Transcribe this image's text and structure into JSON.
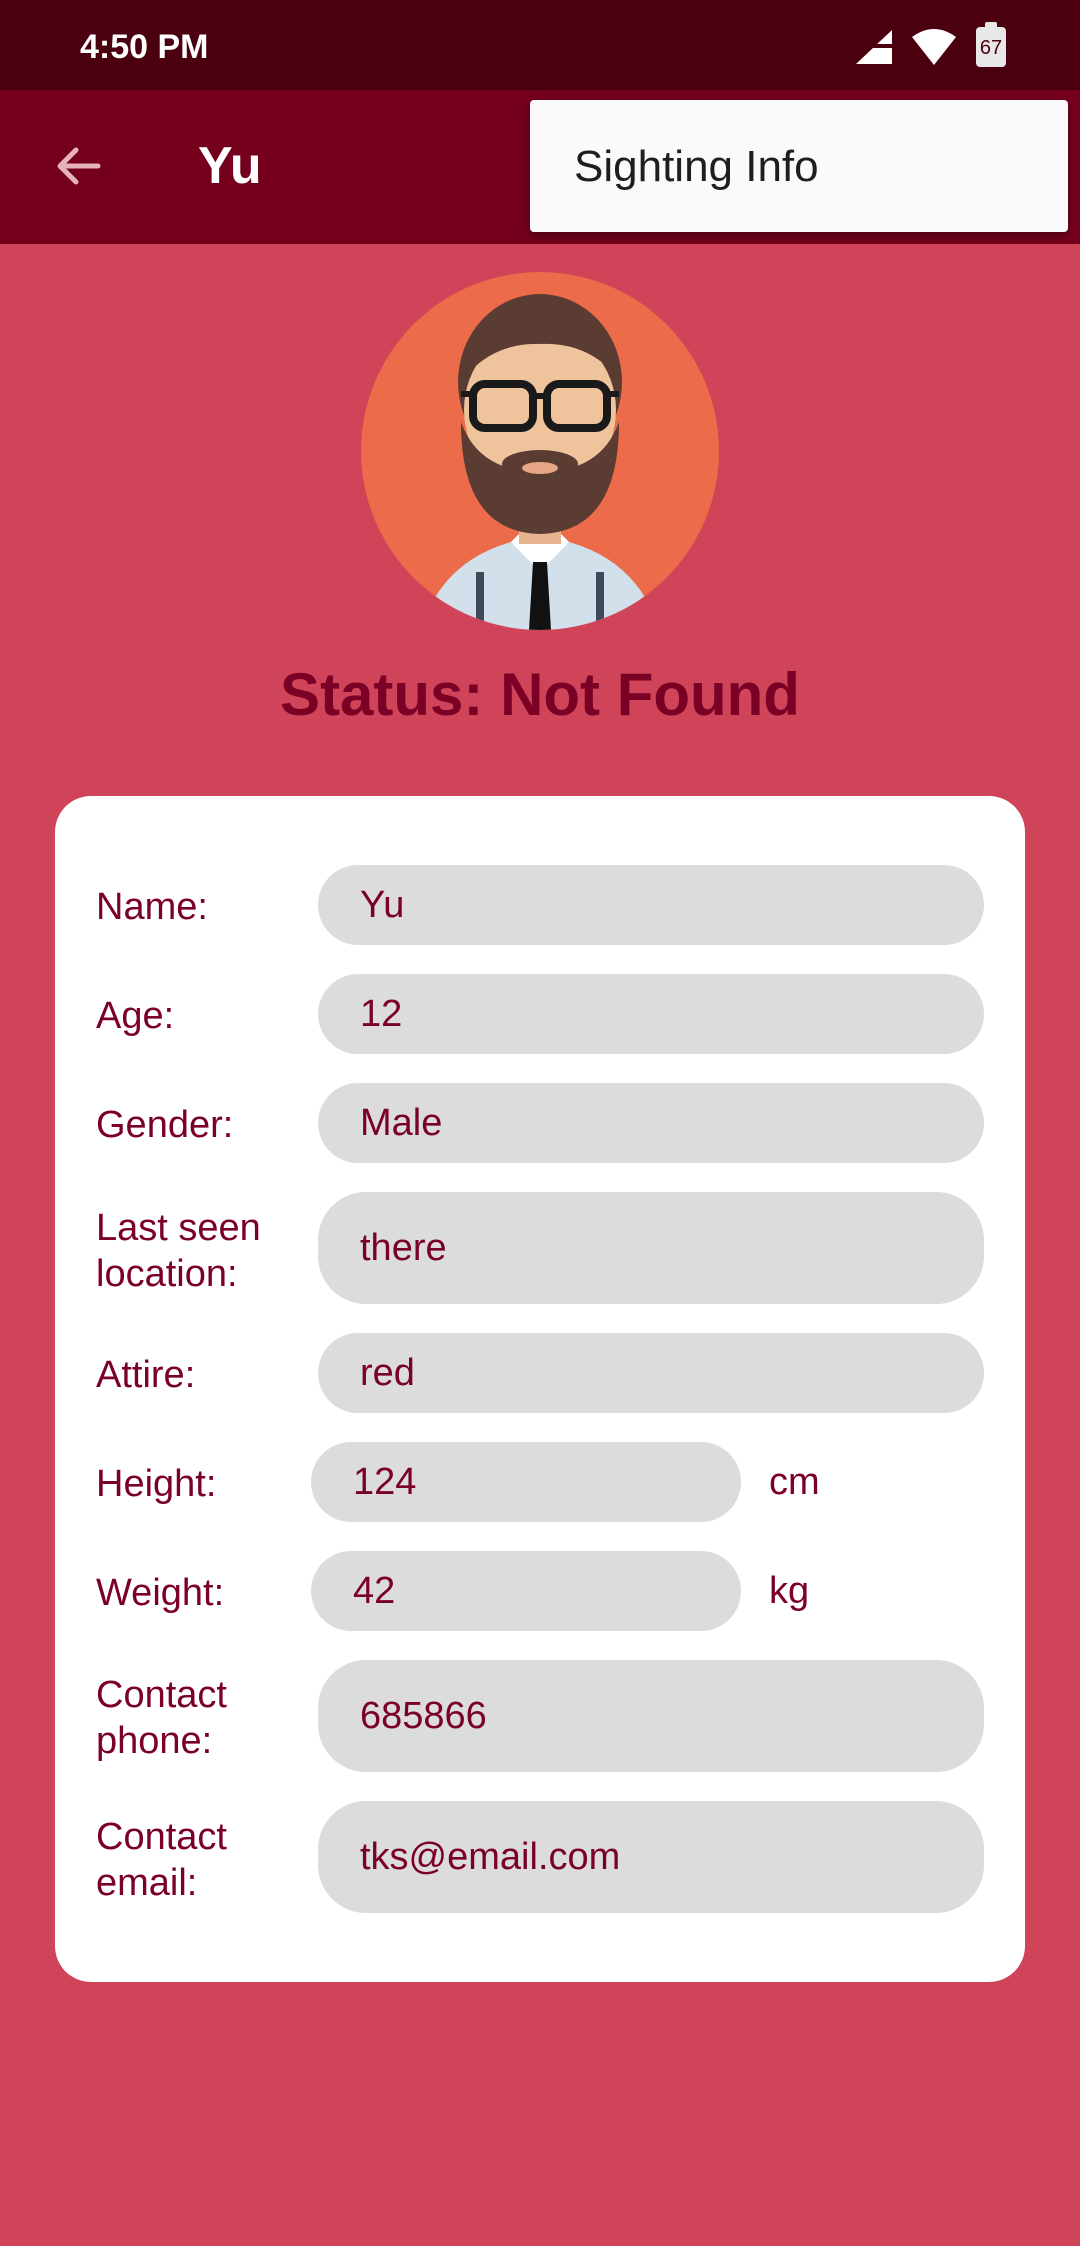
{
  "status_bar": {
    "time": "4:50 PM",
    "battery": "67"
  },
  "app_bar": {
    "title": "Yu"
  },
  "menu": {
    "item": "Sighting Info"
  },
  "status": "Status: Not Found",
  "form": {
    "name": {
      "label": "Name:",
      "value": "Yu"
    },
    "age": {
      "label": "Age:",
      "value": "12"
    },
    "gender": {
      "label": "Gender:",
      "value": "Male"
    },
    "location": {
      "label_line1": "Last seen",
      "label_line2": "location:",
      "value": "there"
    },
    "attire": {
      "label": "Attire:",
      "value": "red"
    },
    "height": {
      "label": "Height:",
      "value": "124",
      "unit": "cm"
    },
    "weight": {
      "label": "Weight:",
      "value": "42",
      "unit": "kg"
    },
    "phone": {
      "label_line1": "Contact",
      "label_line2": "phone:",
      "value": "685866"
    },
    "email": {
      "label_line1": "Contact",
      "label_line2": "email:",
      "value": "tks@email.com"
    }
  },
  "colors": {
    "background": "#cf4458",
    "app_bar": "#75001e",
    "status_bar": "#4b000f",
    "text_accent": "#7a0026",
    "field_bg": "#dcdcdc"
  }
}
